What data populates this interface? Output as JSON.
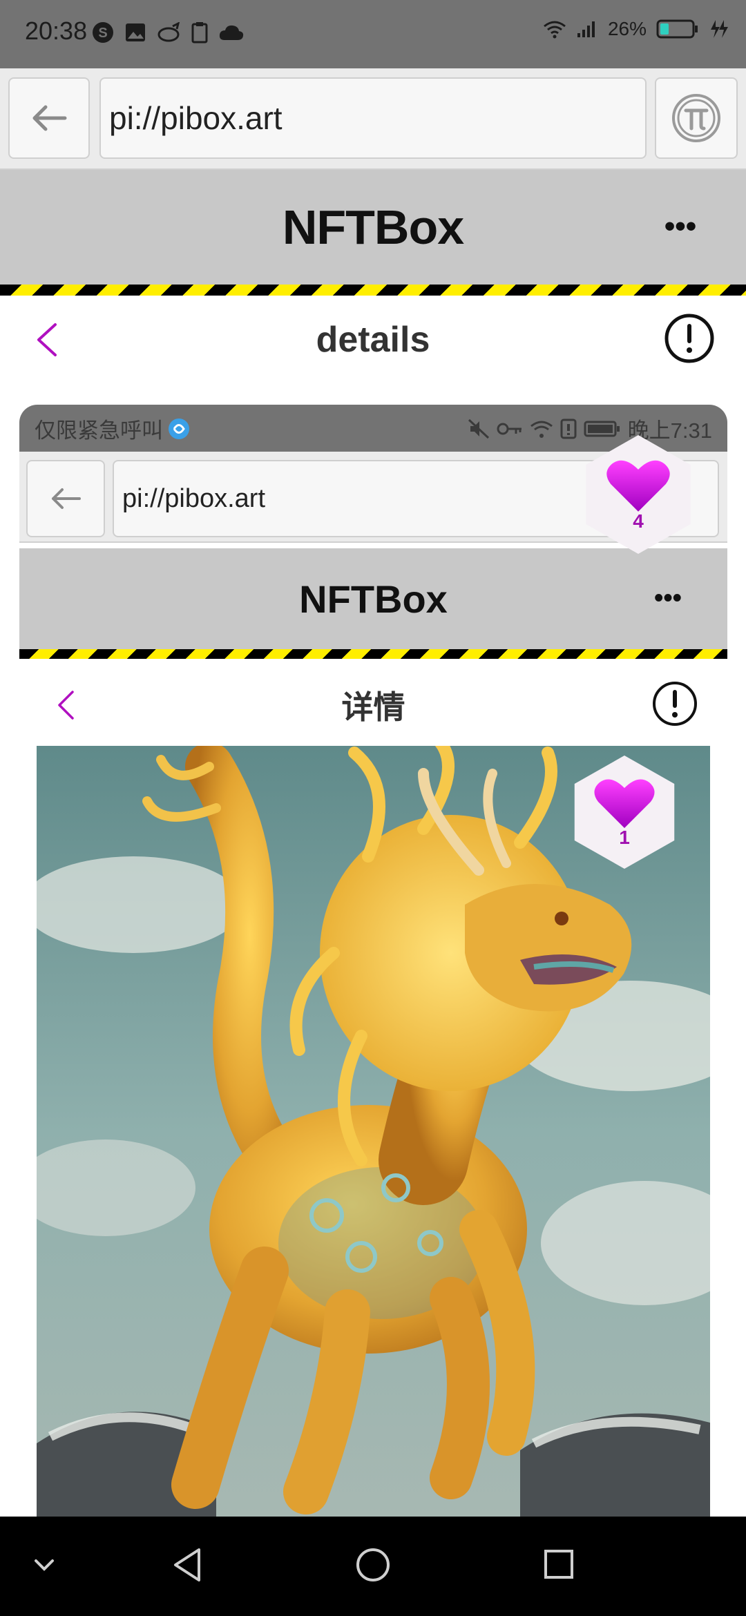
{
  "status_bar": {
    "time": "20:38",
    "battery_percent": "26%",
    "icons_left": [
      "s-icon",
      "image-icon",
      "bird-icon",
      "clipboard-icon",
      "cloud-icon"
    ],
    "icons_right": [
      "wifi-icon",
      "signal-icon",
      "battery-icon",
      "charging-icon"
    ]
  },
  "browser": {
    "url": "pi://pibox.art",
    "back_icon": "arrow-left-icon",
    "pi_icon": "pi-logo-icon"
  },
  "app": {
    "title": "NFTBox",
    "more_label": "•••"
  },
  "details": {
    "title": "details",
    "back_icon": "chevron-left-icon",
    "info_icon": "info-icon"
  },
  "inner_screenshot": {
    "status_left_text": "仅限紧急呼叫",
    "status_right_time": "晚上7:31",
    "url": "pi://pibox.art",
    "app_title": "NFTBox",
    "more_label": "•••",
    "details_title": "详情",
    "like_count": "1"
  },
  "like_badge": {
    "count": "4"
  },
  "colors": {
    "accent": "#b010c0",
    "status_bar": "#737373",
    "header": "#c8c8c8",
    "hazard_yellow": "#ffee00",
    "hazard_black": "#000000"
  },
  "nav_bar": {
    "icons": [
      "chevron-down-icon",
      "back-triangle-icon",
      "home-circle-icon",
      "recents-square-icon"
    ]
  }
}
